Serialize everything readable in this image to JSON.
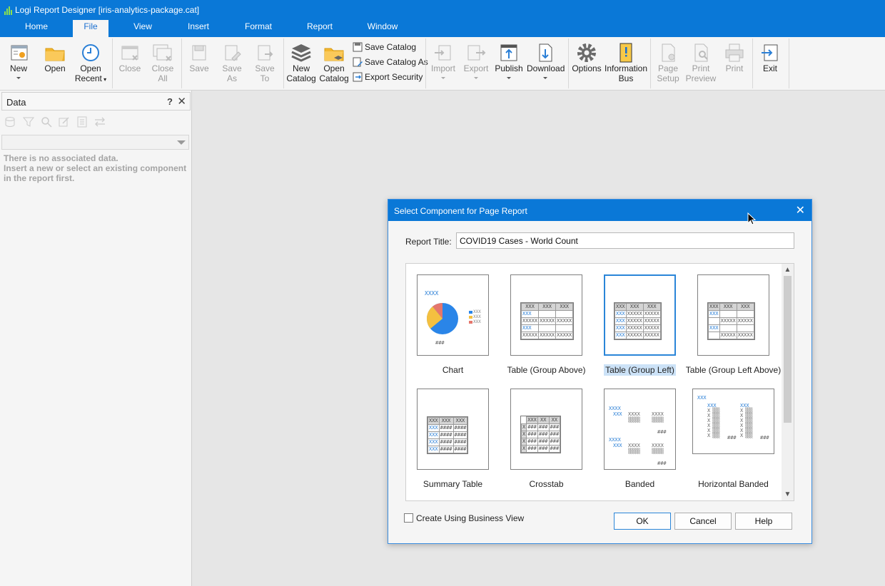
{
  "window": {
    "title": "Logi Report Designer [iris-analytics-package.cat]"
  },
  "menu_tabs": [
    "Home",
    "File",
    "View",
    "Insert",
    "Format",
    "Report",
    "Window"
  ],
  "active_tab": "File",
  "ribbon": {
    "new": {
      "line1": "New",
      "line2": ""
    },
    "open": {
      "line1": "Open",
      "line2": ""
    },
    "open_recent": {
      "line1": "Open",
      "line2": "Recent"
    },
    "close": {
      "line1": "Close",
      "line2": ""
    },
    "close_all": {
      "line1": "Close",
      "line2": "All"
    },
    "save": {
      "line1": "Save",
      "line2": ""
    },
    "save_as": {
      "line1": "Save",
      "line2": "As"
    },
    "save_to": {
      "line1": "Save",
      "line2": "To"
    },
    "new_catalog": {
      "line1": "New",
      "line2": "Catalog"
    },
    "open_catalog": {
      "line1": "Open",
      "line2": "Catalog"
    },
    "save_catalog": "Save Catalog",
    "save_catalog_as": "Save Catalog As",
    "export_security": "Export Security",
    "import": {
      "line1": "Import",
      "line2": ""
    },
    "export": {
      "line1": "Export",
      "line2": ""
    },
    "publish": {
      "line1": "Publish",
      "line2": ""
    },
    "download": {
      "line1": "Download",
      "line2": ""
    },
    "options": {
      "line1": "Options",
      "line2": ""
    },
    "information_bus": {
      "line1": "Information",
      "line2": "Bus"
    },
    "page_setup": {
      "line1": "Page",
      "line2": "Setup"
    },
    "print_preview": {
      "line1": "Print",
      "line2": "Preview"
    },
    "print": {
      "line1": "Print",
      "line2": ""
    },
    "exit": {
      "line1": "Exit",
      "line2": ""
    }
  },
  "data_panel": {
    "title": "Data",
    "help": "?",
    "close": "✕",
    "message_line1": "There is no associated data.",
    "message_line2": "Insert a new or select an existing component",
    "message_line3": "in the report first."
  },
  "dialog": {
    "title": "Select Component for Page Report",
    "close": "✕",
    "report_title_label": "Report Title:",
    "report_title_value": "COVID19 Cases - World Count",
    "components": [
      "Chart",
      "Table (Group Above)",
      "Table (Group Left)",
      "Table (Group Left Above)",
      "Summary Table",
      "Crosstab",
      "Banded",
      "Horizontal Banded"
    ],
    "selected_component": "Table (Group Left)",
    "business_view_label": "Create Using Business View",
    "business_view_checked": false,
    "ok": "OK",
    "cancel": "Cancel",
    "help": "Help"
  },
  "thumb_text": {
    "xxx": "XXX",
    "xxxx": "XXXX",
    "xxxxx": "XXXXX",
    "hash3": "###",
    "hash4": "####",
    "xx": "XX",
    "x": "X",
    "legend_xxx": "XXX"
  },
  "colors": {
    "brand_blue": "#0a78d7",
    "selection": "#cce2f7",
    "accent_blue": "#2a7fd6"
  }
}
